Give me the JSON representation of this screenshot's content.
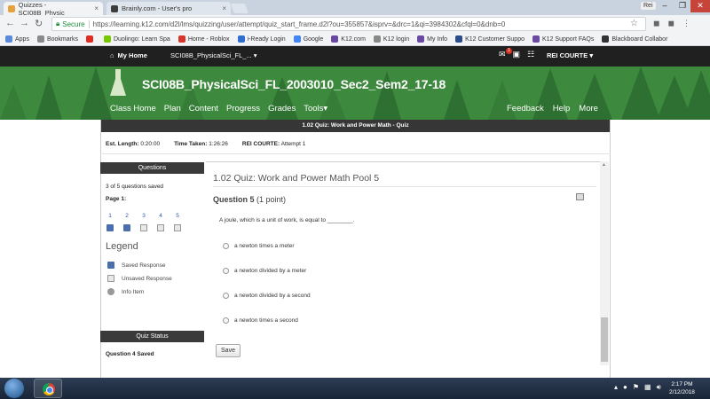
{
  "browser": {
    "tabs": [
      {
        "title": "Quizzes - SCI08B_Physic",
        "active": true
      },
      {
        "title": "Brainly.com - User's pro",
        "active": false
      }
    ],
    "profile": "Rei",
    "address": {
      "secure_label": "Secure",
      "url": "https://learning.k12.com/d2l/lms/quizzing/user/attempt/quiz_start_frame.d2l?ou=355857&isprv=&drc=1&qi=3984302&cfql=0&dnb=0"
    },
    "bookmarks": [
      {
        "label": "Apps",
        "color": "#5a8ad8"
      },
      {
        "label": "Bookmarks",
        "color": "#8a8a8a"
      },
      {
        "label": "",
        "color": "#e02b20"
      },
      {
        "label": "Duolingo: Learn Spa",
        "color": "#78c800"
      },
      {
        "label": "Home - Roblox",
        "color": "#d8352a"
      },
      {
        "label": "i-Ready Login",
        "color": "#2f6fcf"
      },
      {
        "label": "Google",
        "color": "#4285f4"
      },
      {
        "label": "K12.com",
        "color": "#6a4aa0"
      },
      {
        "label": "K12 login",
        "color": "#888888"
      },
      {
        "label": "My Info",
        "color": "#6a4aa0"
      },
      {
        "label": "K12 Customer Suppo",
        "color": "#2b4d8a"
      },
      {
        "label": "K12 Support FAQs",
        "color": "#6a4aa0"
      },
      {
        "label": "Blackboard Collabor",
        "color": "#333333"
      }
    ]
  },
  "k12": {
    "my_home": "My Home",
    "course_crumb": "SCI08B_PhysicalSci_FL_...",
    "notification_count": "1",
    "user": "REI COURTE",
    "course_title": "SCI08B_PhysicalSci_FL_2003010_Sec2_Sem2_17-18",
    "menu_left": [
      "Class Home",
      "Plan",
      "Content",
      "Progress",
      "Grades",
      "Tools"
    ],
    "menu_right": [
      "Feedback",
      "Help",
      "More"
    ],
    "colors": {
      "nav_bg": "#202020",
      "banner_green": "#3d8a3e"
    }
  },
  "quiz": {
    "header": "1.02 Quiz: Work and Power Math - Quiz",
    "est_length_label": "Est. Length:",
    "est_length": "0:20:00",
    "time_taken_label": "Time Taken:",
    "time_taken": "1:26:26",
    "user_label": "REI COURTE:",
    "attempt": "Attempt 1",
    "left_panel": {
      "questions_heading": "Questions",
      "saved_count": "3 of 5 questions saved",
      "page_label": "Page 1:",
      "questions": [
        {
          "num": "1",
          "state": "saved"
        },
        {
          "num": "2",
          "state": "saved"
        },
        {
          "num": "3",
          "state": "unsaved"
        },
        {
          "num": "4",
          "state": "unsaved"
        },
        {
          "num": "5",
          "state": "unsaved"
        }
      ],
      "legend_title": "Legend",
      "legend": [
        {
          "label": "Saved Response",
          "icon": "saved-response-icon"
        },
        {
          "label": "Unsaved Response",
          "icon": "unsaved-response-icon"
        },
        {
          "label": "Info Item",
          "icon": "info-item-icon"
        }
      ],
      "status_heading": "Quiz Status",
      "status_text": "Question 4 Saved"
    },
    "main": {
      "pool_title": "1.02 Quiz: Work and Power Math Pool 5",
      "question_label": "Question 5",
      "points": "(1 point)",
      "question_text": "A joule, which is a unit of work, is equal to ________.",
      "options": [
        "a newton times a meter",
        "a  newton divided by a meter",
        "a newton divided by a second",
        "a newton times a second"
      ],
      "save_label": "Save"
    }
  },
  "taskbar": {
    "time": "2:17 PM",
    "date": "2/12/2018"
  }
}
